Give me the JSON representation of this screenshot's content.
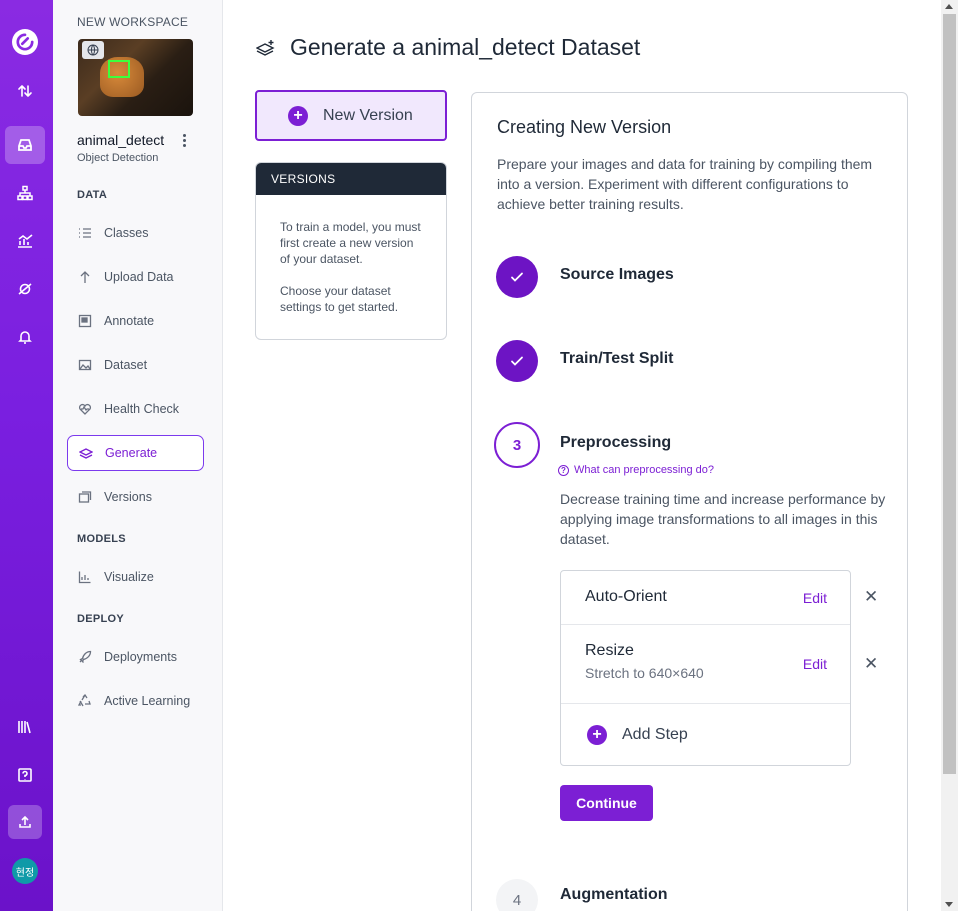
{
  "workspace": {
    "label": "NEW WORKSPACE",
    "dataset_name": "animal_detect",
    "dataset_type": "Object Detection"
  },
  "sidebar": {
    "sections": {
      "data": "DATA",
      "models": "MODELS",
      "deploy": "DEPLOY"
    },
    "items": [
      {
        "label": "Classes",
        "icon": "list-icon"
      },
      {
        "label": "Upload Data",
        "icon": "upload-arrow-icon"
      },
      {
        "label": "Annotate",
        "icon": "annotate-icon"
      },
      {
        "label": "Dataset",
        "icon": "image-icon"
      },
      {
        "label": "Health Check",
        "icon": "heart-pulse-icon"
      },
      {
        "label": "Generate",
        "icon": "layers-icon",
        "active": true
      },
      {
        "label": "Versions",
        "icon": "versions-icon"
      },
      {
        "label": "Visualize",
        "icon": "chart-icon"
      },
      {
        "label": "Deployments",
        "icon": "rocket-icon"
      },
      {
        "label": "Active Learning",
        "icon": "recycle-icon"
      }
    ]
  },
  "rail": {
    "avatar_text": "현정"
  },
  "header": {
    "title": "Generate a animal_detect Dataset"
  },
  "new_version": {
    "label": "New Version"
  },
  "versions": {
    "heading": "VERSIONS",
    "text1": "To train a model, you must first create a new version of your dataset.",
    "text2": "Choose your dataset settings to get started."
  },
  "panel": {
    "title": "Creating New Version",
    "description": "Prepare your images and data for training by compiling them into a version. Experiment with different configurations to achieve better training results.",
    "steps": [
      {
        "label": "Source Images",
        "status": "done"
      },
      {
        "label": "Train/Test Split",
        "status": "done"
      },
      {
        "label": "Preprocessing",
        "number": "3",
        "status": "current"
      },
      {
        "label": "Augmentation",
        "number": "4",
        "status": "pending"
      }
    ],
    "help_link": "What can preprocessing do?",
    "preprocessing_description": "Decrease training time and increase performance by applying image transformations to all images in this dataset.",
    "preprocessing_steps": [
      {
        "name": "Auto-Orient",
        "detail": "",
        "edit": "Edit"
      },
      {
        "name": "Resize",
        "detail": "Stretch to 640×640",
        "edit": "Edit"
      }
    ],
    "add_step": "Add Step",
    "continue": "Continue"
  },
  "colors": {
    "accent": "#7c1fd4",
    "rail": "#8a2be2",
    "dark": "#1f2937"
  }
}
